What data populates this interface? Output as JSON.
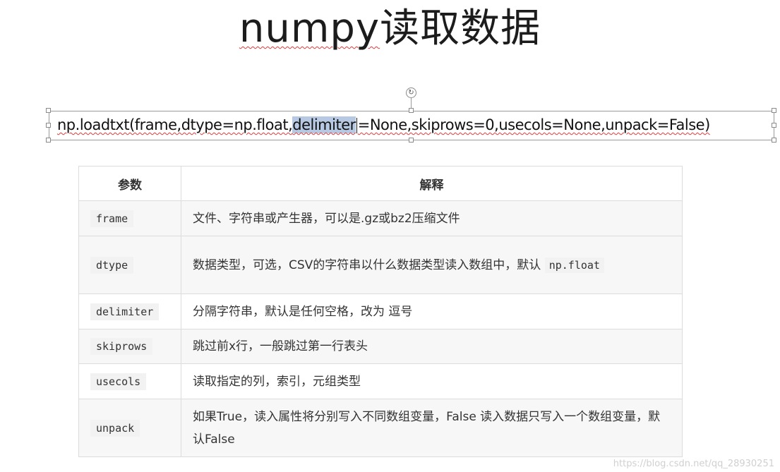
{
  "slide": {
    "title_latin": "numpy",
    "title_cjk": "读取数据"
  },
  "code": {
    "before": "np.loadtxt(frame,dtype=np.float,",
    "selected": "delimiter",
    "after": "=None,skiprows=0,usecols=None,unpack=False)"
  },
  "table": {
    "headers": [
      "参数",
      "解释"
    ],
    "rows": [
      {
        "param": "frame",
        "desc": "文件、字符串或产生器，可以是.gz或bz2压缩文件",
        "desc_code": ""
      },
      {
        "param": "dtype",
        "desc": "数据类型，可选，CSV的字符串以什么数据类型读入数组中，默认 ",
        "desc_code": "np.float"
      },
      {
        "param": "delimiter",
        "desc": "分隔字符串，默认是任何空格，改为 逗号",
        "desc_code": ""
      },
      {
        "param": "skiprows",
        "desc": "跳过前x行，一般跳过第一行表头",
        "desc_code": ""
      },
      {
        "param": "usecols",
        "desc": "读取指定的列，索引，元组类型",
        "desc_code": ""
      },
      {
        "param": "unpack",
        "desc": "如果True，读入属性将分别写入不同数组变量，False 读入数据只写入一个数组变量，默认False",
        "desc_code": ""
      }
    ]
  },
  "watermark": "https://blog.csdn.net/qq_28930251",
  "colors": {
    "selection": "#b7c9e2",
    "spellcheck": "#e03a3a",
    "table_border": "#dcdcdc"
  }
}
